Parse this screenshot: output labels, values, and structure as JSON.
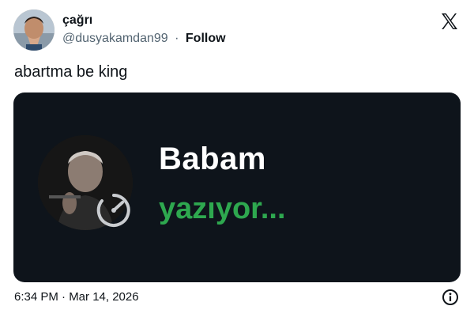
{
  "author": {
    "display_name": "çağrı",
    "handle": "@dusyakamdan99",
    "separator": "·",
    "follow_label": "Follow"
  },
  "tweet": {
    "text": "abartma be king",
    "timestamp": "6:34 PM · Mar 14, 2026"
  },
  "media": {
    "chat_name": "Babam",
    "chat_status": "yazıyor...",
    "status_color": "#2ea84f",
    "background_color": "#0e141b"
  },
  "icons": {
    "brand": "x-logo-icon",
    "info": "info-icon",
    "speed": "speedometer-icon"
  }
}
